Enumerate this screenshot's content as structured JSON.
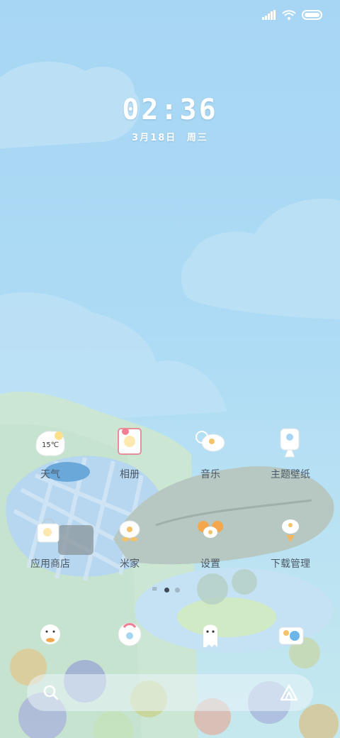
{
  "status_bar": {
    "icons": [
      "signal-icon",
      "wifi-icon",
      "battery-icon"
    ]
  },
  "clock": {
    "time": "02:36",
    "date": "3月18日",
    "weekday": "周三"
  },
  "apps_row1": [
    {
      "label": "天气",
      "icon": "weather-icon",
      "badge": "15℃"
    },
    {
      "label": "相册",
      "icon": "gallery-icon"
    },
    {
      "label": "音乐",
      "icon": "music-icon"
    },
    {
      "label": "主题壁纸",
      "icon": "themes-icon"
    }
  ],
  "apps_row2": [
    {
      "label": "应用商店",
      "icon": "app-store-icon"
    },
    {
      "label": "米家",
      "icon": "mi-home-icon"
    },
    {
      "label": "设置",
      "icon": "settings-icon"
    },
    {
      "label": "下载管理",
      "icon": "downloads-icon"
    }
  ],
  "dock": [
    {
      "icon": "phone-icon"
    },
    {
      "icon": "messages-icon"
    },
    {
      "icon": "browser-icon"
    },
    {
      "icon": "camera-icon"
    }
  ],
  "page_indicator": {
    "pages": 3,
    "active": 0
  },
  "search_bar": {
    "left_icon": "search-icon",
    "right_icon": "assistant-icon"
  },
  "colors": {
    "sky": "#a7d6f4",
    "label": "#4d5a66",
    "white": "#ffffff"
  }
}
